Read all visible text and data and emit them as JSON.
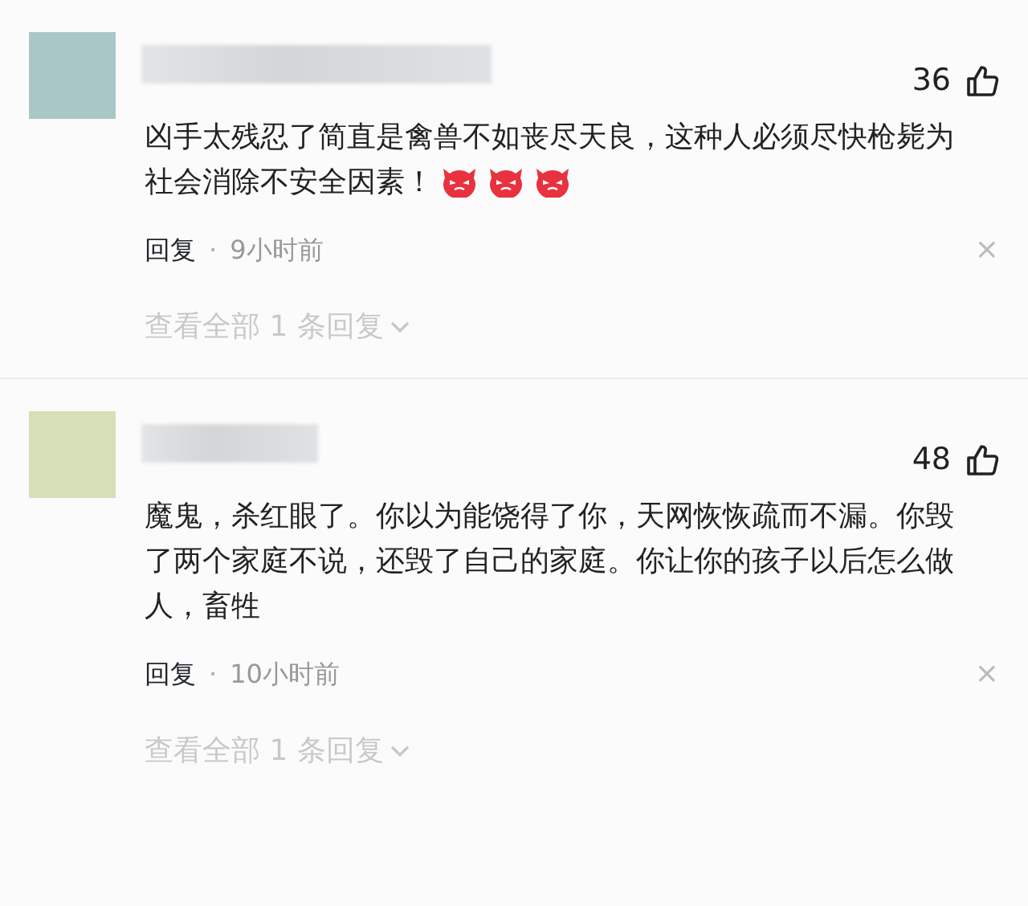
{
  "comments": [
    {
      "avatar": {
        "color": "#a9c7c7"
      },
      "likes": "36",
      "text": "凶手太残忍了简直是禽兽不如丧尽天良，这种人必须尽快枪毙为社会消除不安全因素！",
      "emojis": [
        {
          "kind": "devil"
        },
        {
          "kind": "devil"
        },
        {
          "kind": "devil"
        }
      ],
      "reply": "回复",
      "separator": "·",
      "time": "9小时前",
      "close": "×",
      "view_replies": "查看全部 1 条回复"
    },
    {
      "avatar": {
        "color": "#d5dfb8"
      },
      "likes": "48",
      "text": "魔鬼，杀红眼了。你以为能饶得了你，天网恢恢疏而不漏。你毁了两个家庭不说，还毁了自己的家庭。你让你的孩子以后怎么做人，畜牲",
      "reply": "回复",
      "separator": "·",
      "time": "10小时前",
      "close": "×",
      "view_replies": "查看全部 1 条回复"
    }
  ]
}
